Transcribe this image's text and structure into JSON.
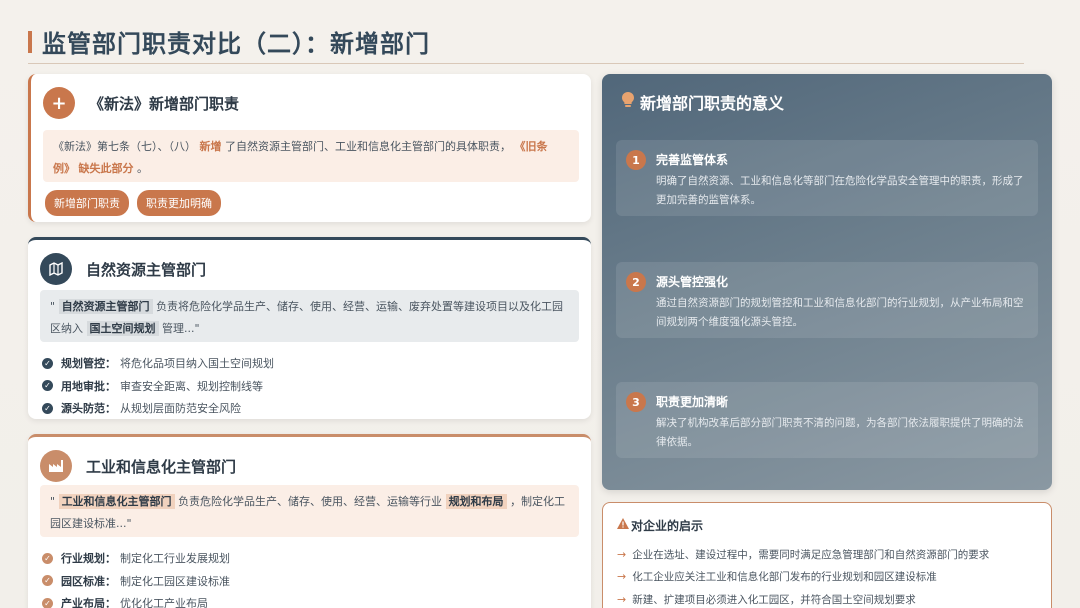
{
  "page": {
    "title": "监管部门职责对比（二）：新增部门"
  },
  "card_new_law": {
    "icon": "plus-icon",
    "title": "《新法》新增部门职责",
    "quote_parts": [
      "《新法》第七条（七）、（八）",
      "新增",
      "了自然资源主管部门、工业和信息化主管部门的具体职责，",
      "《旧条例》",
      "缺失此部分",
      "。"
    ],
    "tags": [
      "新增部门职责",
      "职责更加明确"
    ]
  },
  "card_natural": {
    "icon": "map-icon",
    "title": "自然资源主管部门",
    "quote_parts": [
      "\"",
      "自然资源主管部门",
      "负责将危险化学品生产、储存、使用、经营、运输、废弃处置等建设项目以及化工园区纳入",
      "国土空间规划",
      "管理...\""
    ],
    "bullets": [
      {
        "label": "规划管控：",
        "text": "将危化品项目纳入国土空间规划"
      },
      {
        "label": "用地审批：",
        "text": "审查安全距离、规划控制线等"
      },
      {
        "label": "源头防范：",
        "text": "从规划层面防范安全风险"
      }
    ]
  },
  "card_industry": {
    "icon": "factory-icon",
    "title": "工业和信息化主管部门",
    "quote_parts": [
      "\"",
      "工业和信息化主管部门",
      "负责危险化学品生产、储存、使用、经营、运输等行业",
      "规划和布局",
      "，制定化工园区建设标准...\""
    ],
    "bullets": [
      {
        "label": "行业规划：",
        "text": "制定化工行业发展规划"
      },
      {
        "label": "园区标准：",
        "text": "制定化工园区建设标准"
      },
      {
        "label": "产业布局：",
        "text": "优化化工产业布局"
      }
    ]
  },
  "significance": {
    "icon": "lightbulb-icon",
    "title": "新增部门职责的意义",
    "items": [
      {
        "num": "1",
        "title": "完善监管体系",
        "desc": "明确了自然资源、工业和信息化等部门在危险化学品安全管理中的职责，形成了更加完善的监管体系。"
      },
      {
        "num": "2",
        "title": "源头管控强化",
        "desc": "通过自然资源部门的规划管控和工业和信息化部门的行业规划，从产业布局和空间规划两个维度强化源头管控。"
      },
      {
        "num": "3",
        "title": "职责更加清晰",
        "desc": "解决了机构改革后部分部门职责不清的问题，为各部门依法履职提供了明确的法律依据。"
      }
    ]
  },
  "insight": {
    "icon": "warning-icon",
    "title": "对企业的启示",
    "items": [
      "企业在选址、建设过程中，需要同时满足应急管理部门和自然资源部门的要求",
      "化工企业应关注工业和信息化部门发布的行业规划和园区建设标准",
      "新建、扩建项目必须进入化工园区，并符合国土空间规划要求"
    ]
  },
  "colors": {
    "accent": "#c9774c",
    "navy": "#34495a",
    "copper": "#c98d6a"
  }
}
